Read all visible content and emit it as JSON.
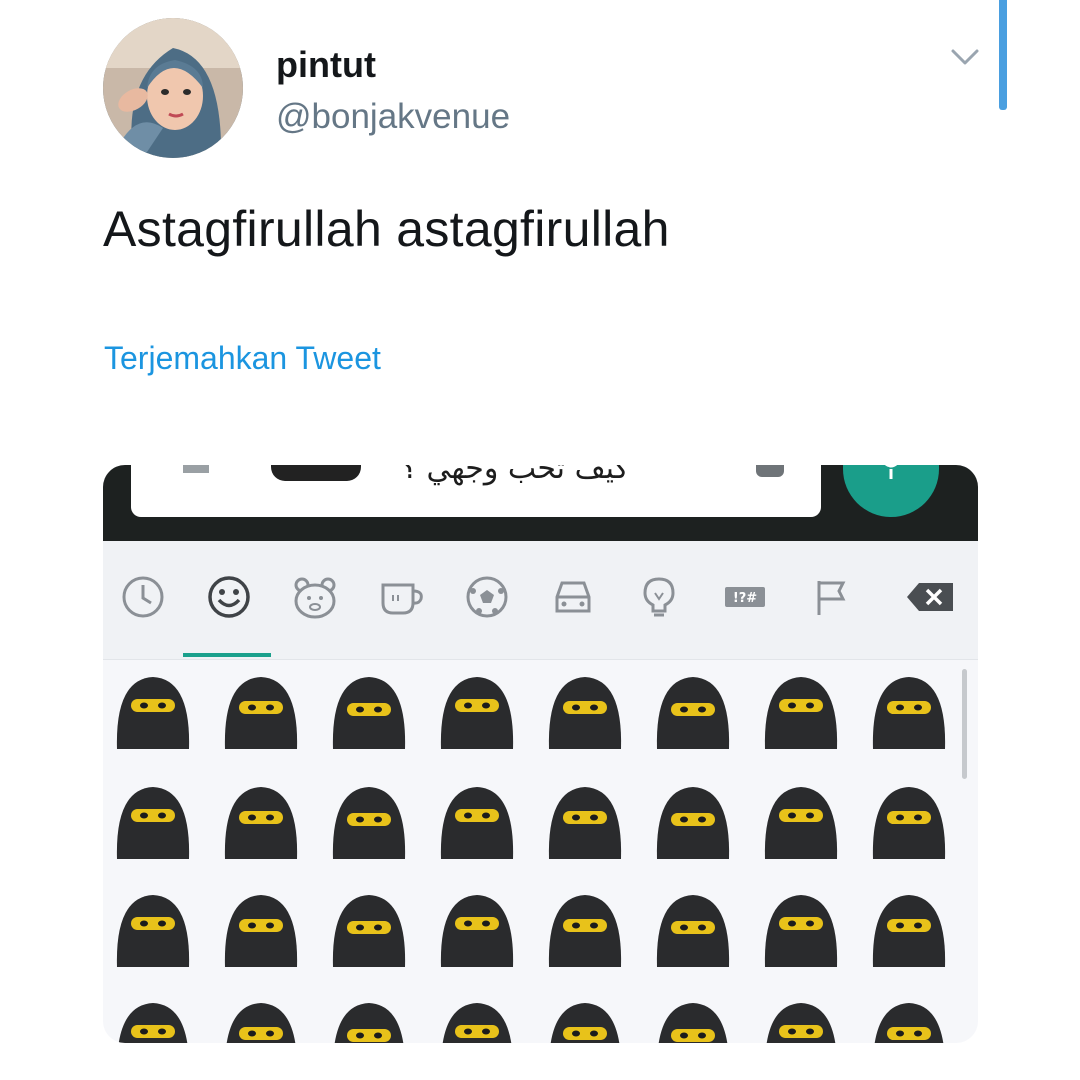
{
  "tweet": {
    "display_name": "pintut",
    "handle": "@bonjakvenue",
    "text": "Astagfirullah astagfirullah",
    "translate_label": "Terjemahkan Tweet"
  },
  "media": {
    "chat_input_text": "كيف تحب وجهي ؟",
    "keyboard_tabs": [
      {
        "name": "recent-tab",
        "icon": "clock-icon"
      },
      {
        "name": "smileys-tab",
        "icon": "smiley-icon",
        "selected": true
      },
      {
        "name": "animals-tab",
        "icon": "bear-icon"
      },
      {
        "name": "food-tab",
        "icon": "cup-icon"
      },
      {
        "name": "activity-tab",
        "icon": "soccer-ball-icon"
      },
      {
        "name": "travel-tab",
        "icon": "car-icon"
      },
      {
        "name": "objects-tab",
        "icon": "lightbulb-icon"
      },
      {
        "name": "symbols-tab",
        "icon": "symbols-icon",
        "label": "!?#"
      },
      {
        "name": "flags-tab",
        "icon": "flag-icon"
      }
    ],
    "emoji_rows": 4,
    "emoji_cols": 8,
    "colors": {
      "link": "#1b95e0",
      "accent": "#1aa08c",
      "niqab": "#2a2b2d",
      "eyes": "#e8c21a"
    }
  }
}
